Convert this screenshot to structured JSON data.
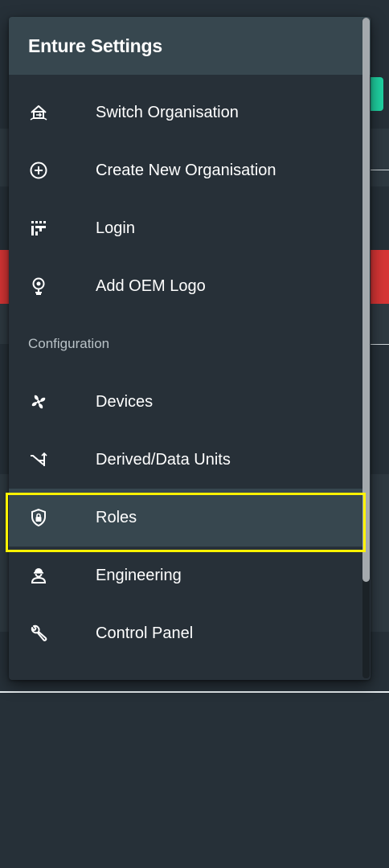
{
  "menu": {
    "title": "Enture Settings",
    "items": [
      {
        "label": "Switch Organisation",
        "icon": "switch-organisation-icon"
      },
      {
        "label": "Create New Organisation",
        "icon": "add-circle-icon"
      },
      {
        "label": "Login",
        "icon": "login-grid-icon"
      },
      {
        "label": "Add OEM Logo",
        "icon": "logo-badge-icon"
      }
    ],
    "section_label": "Configuration",
    "config_items": [
      {
        "label": "Devices",
        "icon": "fan-icon"
      },
      {
        "label": "Derived/Data Units",
        "icon": "derived-units-icon"
      },
      {
        "label": "Roles",
        "icon": "shield-lock-icon",
        "active": true
      },
      {
        "label": "Engineering",
        "icon": "engineer-icon"
      },
      {
        "label": "Control Panel",
        "icon": "wrench-icon"
      }
    ]
  },
  "colors": {
    "background": "#263038",
    "menu_bg": "#273038",
    "header_bg": "#37474f",
    "highlight": "#fff200",
    "accent_green": "#1fd1a1",
    "alert_red": "#d63535"
  }
}
